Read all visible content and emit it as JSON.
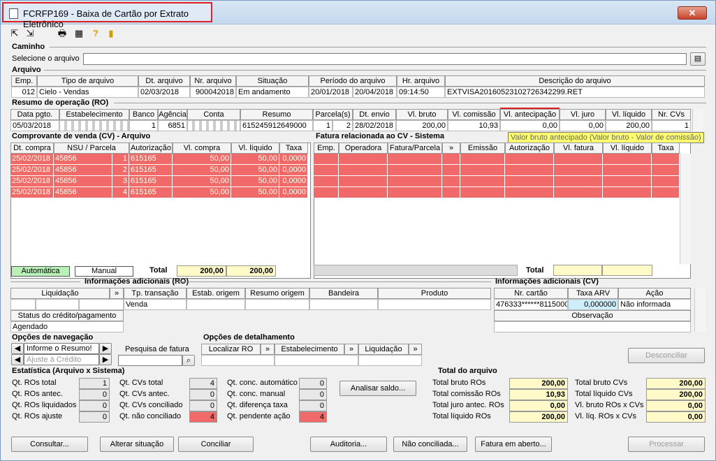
{
  "window": {
    "title": "FCRFP169 - Baixa de Cartão por Extrato Eletrônico",
    "close": "✕"
  },
  "toolbar": {
    "icons": [
      "first-icon",
      "last-icon",
      "print-icon",
      "calendar-icon",
      "help-icon",
      "exit-icon"
    ]
  },
  "caminho": {
    "label": "Caminho",
    "file_label": "Selecione o arquivo",
    "file_value": ""
  },
  "arquivo": {
    "label": "Arquivo",
    "headers": [
      "Emp.",
      "Tipo de arquivo",
      "Dt. arquivo",
      "Nr. arquivo",
      "Situação",
      "Período do arquivo",
      "Hr. arquivo",
      "Descrição do arquivo"
    ],
    "row": [
      "012",
      "Cielo - Vendas",
      "02/03/2018",
      "900042018",
      "Em andamento",
      "20/01/2018",
      "20/04/2018",
      "09:14:50",
      "EXTVISA20160523102726342299.RET"
    ]
  },
  "ro": {
    "label": "Resumo de operação (RO)",
    "headers": [
      "Data pgto.",
      "Estabelecimento",
      "Banco",
      "Agência",
      "Conta",
      "Resumo",
      "Parcela(s)",
      "Dt. envio",
      "Vl. bruto",
      "Vl. comissão",
      "Vl. antecipação",
      "Vl. juro",
      "Vl. líquido",
      "Nr. CVs"
    ],
    "row": [
      "05/03/2018",
      "",
      "1",
      "6851",
      "",
      "615245912649000",
      "1",
      "2",
      "28/02/2018",
      "200,00",
      "10,93",
      "0,00",
      "0,00",
      "200,00",
      "1"
    ],
    "tooltip": "Valor bruto antecipado (Valor bruto - Valor de comissão)"
  },
  "cv": {
    "label": "Comprovante de venda (CV) - Arquivo",
    "headers": [
      "Dt. compra",
      "NSU / Parcela",
      "Autorização",
      "Vl. compra",
      "Vl. líquido",
      "Taxa"
    ],
    "rows": [
      [
        "25/02/2018",
        "45856",
        "1",
        "615165",
        "50,00",
        "50,00",
        "0,0000"
      ],
      [
        "25/02/2018",
        "45856",
        "2",
        "615165",
        "50,00",
        "50,00",
        "0,0000"
      ],
      [
        "25/02/2018",
        "45856",
        "3",
        "615165",
        "50,00",
        "50,00",
        "0,0000"
      ],
      [
        "25/02/2018",
        "45856",
        "4",
        "615165",
        "50,00",
        "50,00",
        "0,0000"
      ]
    ],
    "auto": "Automática",
    "manual": "Manual",
    "total_label": "Total",
    "total_compra": "200,00",
    "total_liquido": "200,00"
  },
  "fatura": {
    "label": "Fatura relacionada ao CV - Sistema",
    "headers": [
      "Emp.",
      "Operadora",
      "Fatura/Parcela",
      "»",
      "Emissão",
      "Autorização",
      "Vl. fatura",
      "Vl. líquido",
      "Taxa"
    ],
    "total_label": "Total"
  },
  "info_ro": {
    "label": "Informações adicionais (RO)",
    "headers": [
      "Liquidação",
      "»",
      "Tp. transação",
      "Estab. origem",
      "Resumo origem",
      "Bandeira",
      "Produto"
    ],
    "row_tp": "Venda",
    "status_header": "Status do crédito/pagamento",
    "status_value": "Agendado"
  },
  "info_cv": {
    "label": "Informações adicionais (CV)",
    "headers": [
      "Nr. cartão",
      "Taxa ARV",
      "Ação"
    ],
    "row": [
      "476333******8115000",
      "0,000000",
      "Não informada"
    ],
    "obs": "Observação"
  },
  "nav": {
    "label": "Opções de navegação",
    "resumo": "Informe o Resumo!",
    "ajuste": "Ajuste à Crédito",
    "pesquisa": "Pesquisa de fatura"
  },
  "detalhe": {
    "label": "Opções de detalhamento",
    "items": [
      "Localizar RO",
      "»",
      "Estabelecimento",
      "»",
      "Liquidação",
      "»"
    ]
  },
  "desconciliar": "Desconciliar",
  "estat": {
    "label": "Estatística (Arquivo x Sistema)",
    "col1": [
      [
        "Qt. ROs total",
        "1"
      ],
      [
        "Qt. ROs antec.",
        "0"
      ],
      [
        "Qt. ROs liquidados",
        "0"
      ],
      [
        "Qt. ROs ajuste",
        "0"
      ]
    ],
    "col2": [
      [
        "Qt. CVs total",
        "4"
      ],
      [
        "Qt. CVs antec.",
        "0"
      ],
      [
        "Qt. CVs conciliado",
        "0"
      ],
      [
        "Qt. não conciliado",
        "4"
      ]
    ],
    "col3": [
      [
        "Qt. conc. automático",
        "0"
      ],
      [
        "Qt. conc. manual",
        "0"
      ],
      [
        "Qt. diferença taxa",
        "0"
      ],
      [
        "Qt. pendente ação",
        "4"
      ]
    ],
    "analisar": "Analisar saldo..."
  },
  "total": {
    "label": "Total do arquivo",
    "left": [
      [
        "Total bruto ROs",
        "200,00"
      ],
      [
        "Total comissão ROs",
        "10,93"
      ],
      [
        "Total juro antec. ROs",
        "0,00"
      ],
      [
        "Total líquido ROs",
        "200,00"
      ]
    ],
    "right": [
      [
        "Total bruto CVs",
        "200,00"
      ],
      [
        "Total líquido CVs",
        "200,00"
      ],
      [
        "Vl. bruto ROs x CVs",
        "0,00"
      ],
      [
        "Vl. líq. ROs x CVs",
        "0,00"
      ]
    ]
  },
  "footer": [
    "Consultar...",
    "Alterar situação",
    "Conciliar",
    "Auditoria...",
    "Não conciliada...",
    "Fatura em aberto...",
    "Processar"
  ],
  "colors": {
    "red_row": "#f06a6a",
    "yellow": "#fffac8",
    "title_border": "#e02020"
  }
}
